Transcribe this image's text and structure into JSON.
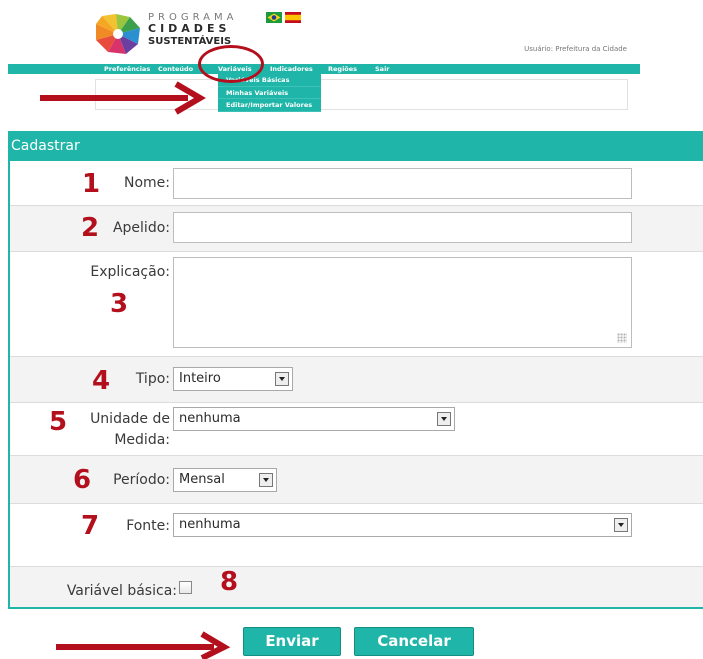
{
  "header": {
    "logo": {
      "line1": "PROGRAMA",
      "line2": "CIDADES",
      "line3": "SUSTENTÁVEIS"
    },
    "flags": [
      "brazil-flag-icon",
      "spain-flag-icon"
    ],
    "user_info": "Usuário: Prefeitura da Cidade"
  },
  "nav": {
    "items": [
      "Preferências",
      "Conteúdo",
      "Variáveis",
      "Indicadores",
      "Regiões",
      "Sair"
    ],
    "dropdown": [
      "Variáveis Básicas",
      "Minhas Variáveis",
      "Editar/Importar Valores"
    ]
  },
  "form": {
    "title": "Cadastrar",
    "fields": {
      "nome": {
        "label": "Nome:",
        "value": "",
        "step": "1"
      },
      "apelido": {
        "label": "Apelido:",
        "value": "",
        "step": "2"
      },
      "explicacao": {
        "label": "Explicação:",
        "value": "",
        "step": "3"
      },
      "tipo": {
        "label": "Tipo:",
        "value": "Inteiro",
        "step": "4"
      },
      "unidade": {
        "label_line1": "Unidade de",
        "label_line2": "Medida:",
        "value": "nenhuma",
        "step": "5"
      },
      "periodo": {
        "label": "Período:",
        "value": "Mensal",
        "step": "6"
      },
      "fonte": {
        "label": "Fonte:",
        "value": "nenhuma",
        "step": "7"
      },
      "basica": {
        "label": "Variável básica:",
        "checked": false,
        "step": "8"
      }
    }
  },
  "actions": {
    "submit": "Enviar",
    "cancel": "Cancelar"
  },
  "colors": {
    "accent": "#1fb5a8",
    "annotation": "#b40f1c"
  }
}
